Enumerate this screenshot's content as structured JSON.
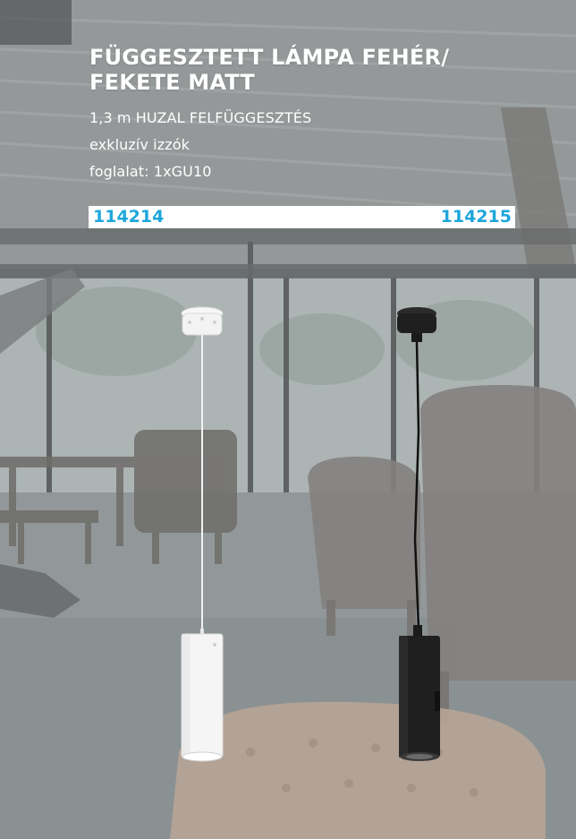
{
  "product": {
    "title_line1": "FÜGGESZTETT LÁMPA FEHÉR/",
    "title_line2": "FEKETE MATT",
    "specs": [
      "1,3 m HUZAL FELFÜGGESZTÉS",
      "exkluzív izzók",
      "foglalat: 1xGU10"
    ],
    "codes": {
      "left": "114214",
      "right": "114215"
    }
  },
  "colors": {
    "title_text": "#ffffff",
    "code_bar_bg": "#ffffff",
    "code_text": "#1ea6db",
    "lamp_white": "#f4f4f4",
    "lamp_black": "#1c1c1c"
  },
  "icons": {
    "lamp_left": "white-pendant-lamp-icon",
    "lamp_right": "black-pendant-lamp-icon"
  }
}
